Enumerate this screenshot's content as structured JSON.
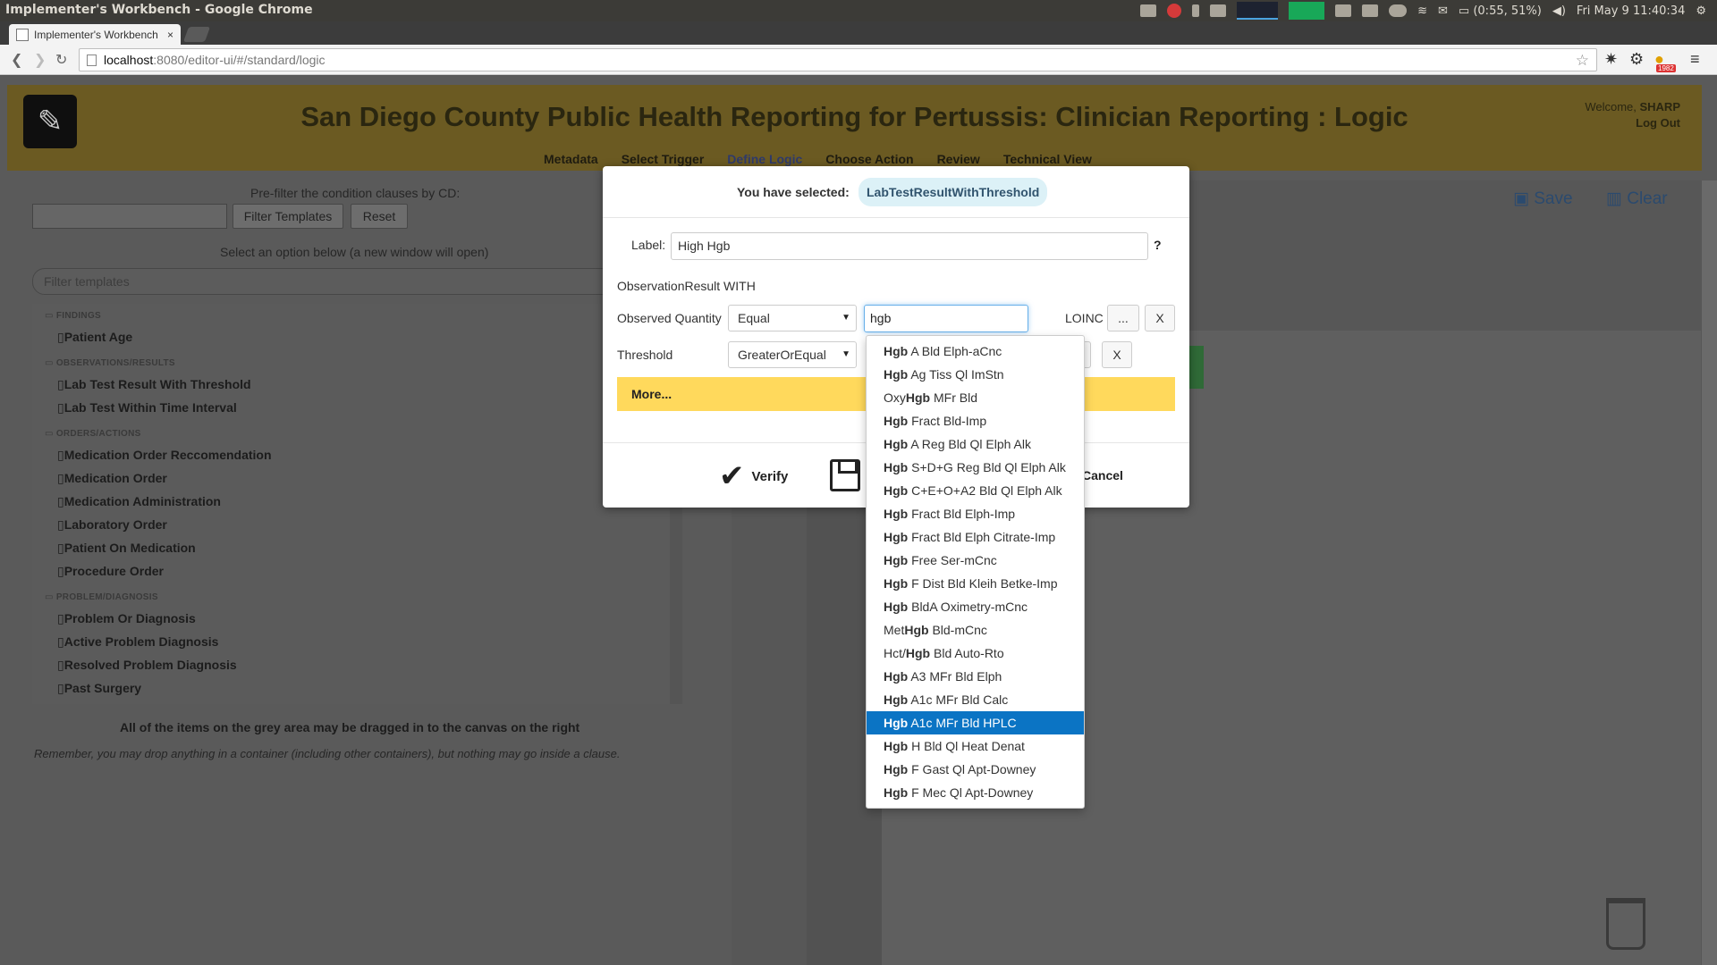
{
  "os": {
    "title": "Implementer's Workbench - Google Chrome",
    "battery": "(0:55, 51%)",
    "clock": "Fri May 9  11:40:34"
  },
  "browser": {
    "tab_title": "Implementer's Workbench",
    "tab_close": "×",
    "url_host": "localhost",
    "url_rest": ":8080/editor-ui/#/standard/logic",
    "badge_count": "1982"
  },
  "app": {
    "title": "San Diego County Public Health Reporting for Pertussis: Clinician Reporting : Logic",
    "nav": [
      "Metadata",
      "Select Trigger",
      "Define Logic",
      "Choose Action",
      "Review",
      "Technical View"
    ],
    "welcome_prefix": "Welcome, ",
    "user": "SHARP",
    "logout": "Log Out",
    "save": "Save",
    "clear": "Clear"
  },
  "left": {
    "prefilter_label": "Pre-filter the condition clauses by CD:",
    "filter_button": "Filter Templates",
    "reset_button": "Reset",
    "select_option": "Select an option below (a new window will open)",
    "filter_placeholder": "Filter templates",
    "tree": [
      {
        "type": "cat",
        "label": "FINDINGS"
      },
      {
        "type": "item",
        "label": "Patient Age"
      },
      {
        "type": "cat",
        "label": "OBSERVATIONS/RESULTS"
      },
      {
        "type": "item",
        "label": "Lab Test Result With Threshold"
      },
      {
        "type": "item",
        "label": "Lab Test Within Time Interval"
      },
      {
        "type": "cat",
        "label": "ORDERS/ACTIONS"
      },
      {
        "type": "item",
        "label": "Medication Order Reccomendation"
      },
      {
        "type": "item",
        "label": "Medication Order"
      },
      {
        "type": "item",
        "label": "Medication Administration"
      },
      {
        "type": "item",
        "label": "Laboratory Order"
      },
      {
        "type": "item",
        "label": "Patient On Medication"
      },
      {
        "type": "item",
        "label": "Procedure Order"
      },
      {
        "type": "cat",
        "label": "PROBLEM/DIAGNOSIS"
      },
      {
        "type": "item",
        "label": "Problem Or Diagnosis"
      },
      {
        "type": "item",
        "label": "Active Problem Diagnosis"
      },
      {
        "type": "item",
        "label": "Resolved Problem Diagnosis"
      },
      {
        "type": "item",
        "label": "Past Surgery"
      }
    ],
    "drag_note": "All of the items on the grey area may be dragged in to the canvas on the right",
    "drop_note": "Remember, you may drop anything in a container (including other containers), but nothing may go inside a clause."
  },
  "modal": {
    "selected_prefix": "You have selected:",
    "selected_value": "LabTestResultWithThreshold",
    "label_label": "Label:",
    "label_value": "High Hgb",
    "help": "?",
    "obs_with": "ObservationResult WITH",
    "observed_quantity_label": "Observed Quantity",
    "observed_quantity_op": "Equal",
    "search_value": "hgb",
    "code_system": "LOINC",
    "ellipsis_button": "...",
    "remove_button": "X",
    "threshold_label": "Threshold",
    "threshold_op": "GreaterOrEqual",
    "more": "More...",
    "verify": "Verify",
    "cancel": "Cancel"
  },
  "suggestions": [
    {
      "pre": "",
      "match": "Hgb",
      "post": " A Bld Elph-aCnc"
    },
    {
      "pre": "",
      "match": "Hgb",
      "post": " Ag Tiss Ql ImStn"
    },
    {
      "pre": "Oxy",
      "match": "Hgb",
      "post": " MFr Bld"
    },
    {
      "pre": "",
      "match": "Hgb",
      "post": " Fract Bld-Imp"
    },
    {
      "pre": "",
      "match": "Hgb",
      "post": " A Reg Bld Ql Elph Alk"
    },
    {
      "pre": "",
      "match": "Hgb",
      "post": " S+D+G Reg Bld Ql Elph Alk"
    },
    {
      "pre": "",
      "match": "Hgb",
      "post": " C+E+O+A2 Bld Ql Elph Alk"
    },
    {
      "pre": "",
      "match": "Hgb",
      "post": " Fract Bld Elph-Imp"
    },
    {
      "pre": "",
      "match": "Hgb",
      "post": " Fract Bld Elph Citrate-Imp"
    },
    {
      "pre": "",
      "match": "Hgb",
      "post": " Free Ser-mCnc"
    },
    {
      "pre": "",
      "match": "Hgb",
      "post": " F Dist Bld Kleih Betke-Imp"
    },
    {
      "pre": "",
      "match": "Hgb",
      "post": " BldA Oximetry-mCnc"
    },
    {
      "pre": "Met",
      "match": "Hgb",
      "post": " Bld-mCnc"
    },
    {
      "pre": "Hct/",
      "match": "Hgb",
      "post": " Bld Auto-Rto"
    },
    {
      "pre": "",
      "match": "Hgb",
      "post": " A3 MFr Bld Elph"
    },
    {
      "pre": "",
      "match": "Hgb",
      "post": " A1c MFr Bld Calc"
    },
    {
      "pre": "",
      "match": "Hgb",
      "post": " A1c MFr Bld HPLC",
      "active": true
    },
    {
      "pre": "",
      "match": "Hgb",
      "post": " H Bld Ql Heat Denat"
    },
    {
      "pre": "",
      "match": "Hgb",
      "post": " F Gast Ql Apt-Downey"
    },
    {
      "pre": "",
      "match": "Hgb",
      "post": " F Mec Ql Apt-Downey"
    }
  ]
}
